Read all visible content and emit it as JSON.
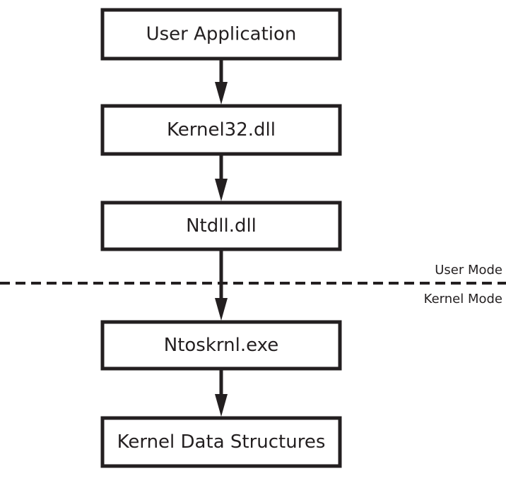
{
  "diagram": {
    "nodes": [
      {
        "id": "user-application",
        "label": "User Application"
      },
      {
        "id": "kernel32",
        "label": "Kernel32.dll"
      },
      {
        "id": "ntdll",
        "label": "Ntdll.dll"
      },
      {
        "id": "ntoskrnl",
        "label": "Ntoskrnl.exe"
      },
      {
        "id": "kernel-data-structures",
        "label": "Kernel Data Structures"
      }
    ],
    "edges": [
      {
        "from": "user-application",
        "to": "kernel32"
      },
      {
        "from": "kernel32",
        "to": "ntdll"
      },
      {
        "from": "ntdll",
        "to": "ntoskrnl"
      },
      {
        "from": "ntoskrnl",
        "to": "kernel-data-structures"
      }
    ],
    "boundary": {
      "style": "dashed",
      "above_label": "User Mode",
      "below_label": "Kernel Mode"
    },
    "colors": {
      "stroke": "#231f20",
      "background": "#ffffff"
    }
  }
}
